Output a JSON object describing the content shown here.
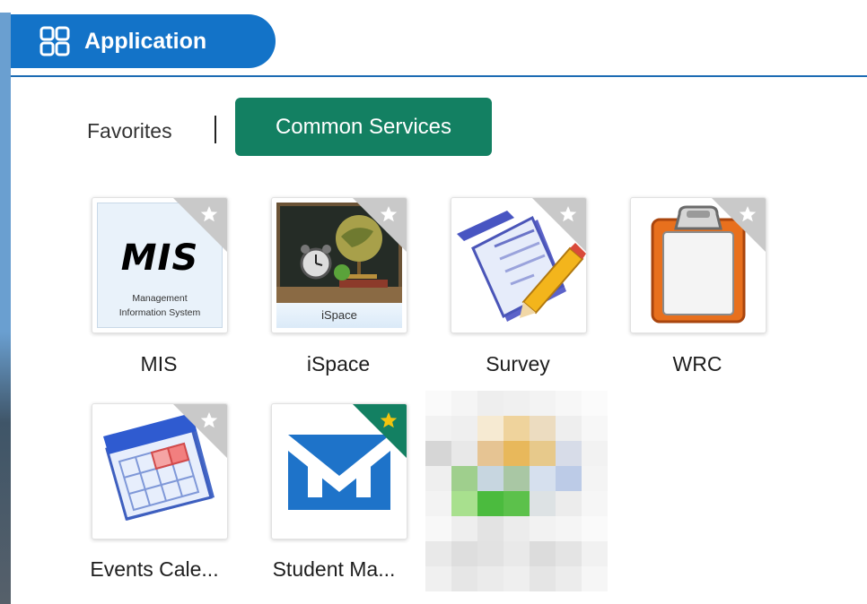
{
  "header": {
    "title": "Application",
    "icon": "grid-icon",
    "accent_color": "#1373c8"
  },
  "tabs": [
    {
      "label": "Favorites",
      "active": false
    },
    {
      "label": "Common Services",
      "active": true,
      "color": "#138062"
    }
  ],
  "apps": [
    {
      "label": "MIS",
      "tile_text": "MIS",
      "tile_subtext_1": "Management",
      "tile_subtext_2": "Information System",
      "favorited": false,
      "icon": "mis-logo-icon"
    },
    {
      "label": "iSpace",
      "tile_text": "iSpace",
      "favorited": false,
      "icon": "ispace-classroom-icon"
    },
    {
      "label": "Survey",
      "favorited": false,
      "icon": "survey-pencil-icon"
    },
    {
      "label": "WRC",
      "favorited": false,
      "icon": "clipboard-icon"
    },
    {
      "label": "Events Cale...",
      "favorited": false,
      "icon": "calendar-icon"
    },
    {
      "label": "Student Ma...",
      "favorited": true,
      "icon": "mail-icon"
    }
  ],
  "colors": {
    "favorite_off": "#c9c9c9",
    "favorite_on": "#138062",
    "star_on": "#f1c40f"
  }
}
